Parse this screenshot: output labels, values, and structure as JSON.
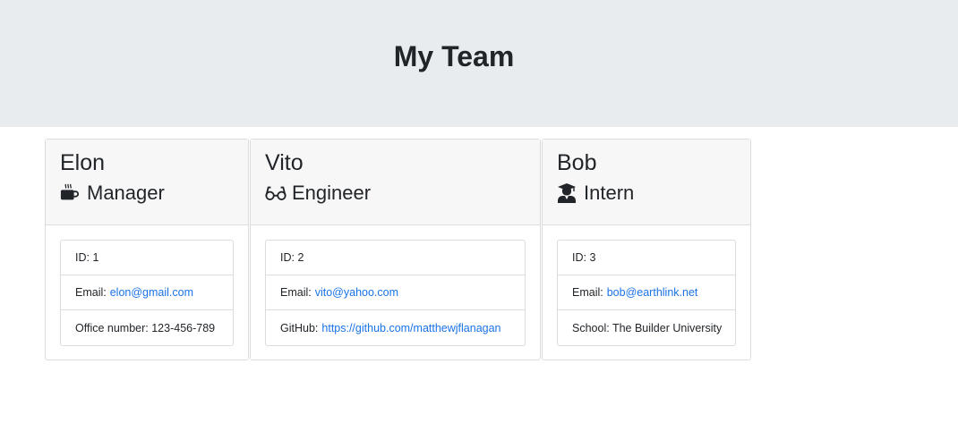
{
  "header": {
    "title": "My Team"
  },
  "colors": {
    "header_bg": "#e9ecef",
    "link": "#1a73e8"
  },
  "employees": [
    {
      "name": "Elon",
      "role": "Manager",
      "role_icon": "coffee-icon",
      "id_text": "ID: 1",
      "email_label": "Email:",
      "email": "elon@gmail.com",
      "extra_text": "Office number: 123-456-789"
    },
    {
      "name": "Vito",
      "role": "Engineer",
      "role_icon": "glasses-icon",
      "id_text": "ID: 2",
      "email_label": "Email:",
      "email": "vito@yahoo.com",
      "extra_label": "GitHub:",
      "extra_link": "https://github.com/matthewjflanagan"
    },
    {
      "name": "Bob",
      "role": "Intern",
      "role_icon": "graduate-icon",
      "id_text": "ID: 3",
      "email_label": "Email:",
      "email": "bob@earthlink.net",
      "extra_text": "School: The Builder University"
    }
  ]
}
